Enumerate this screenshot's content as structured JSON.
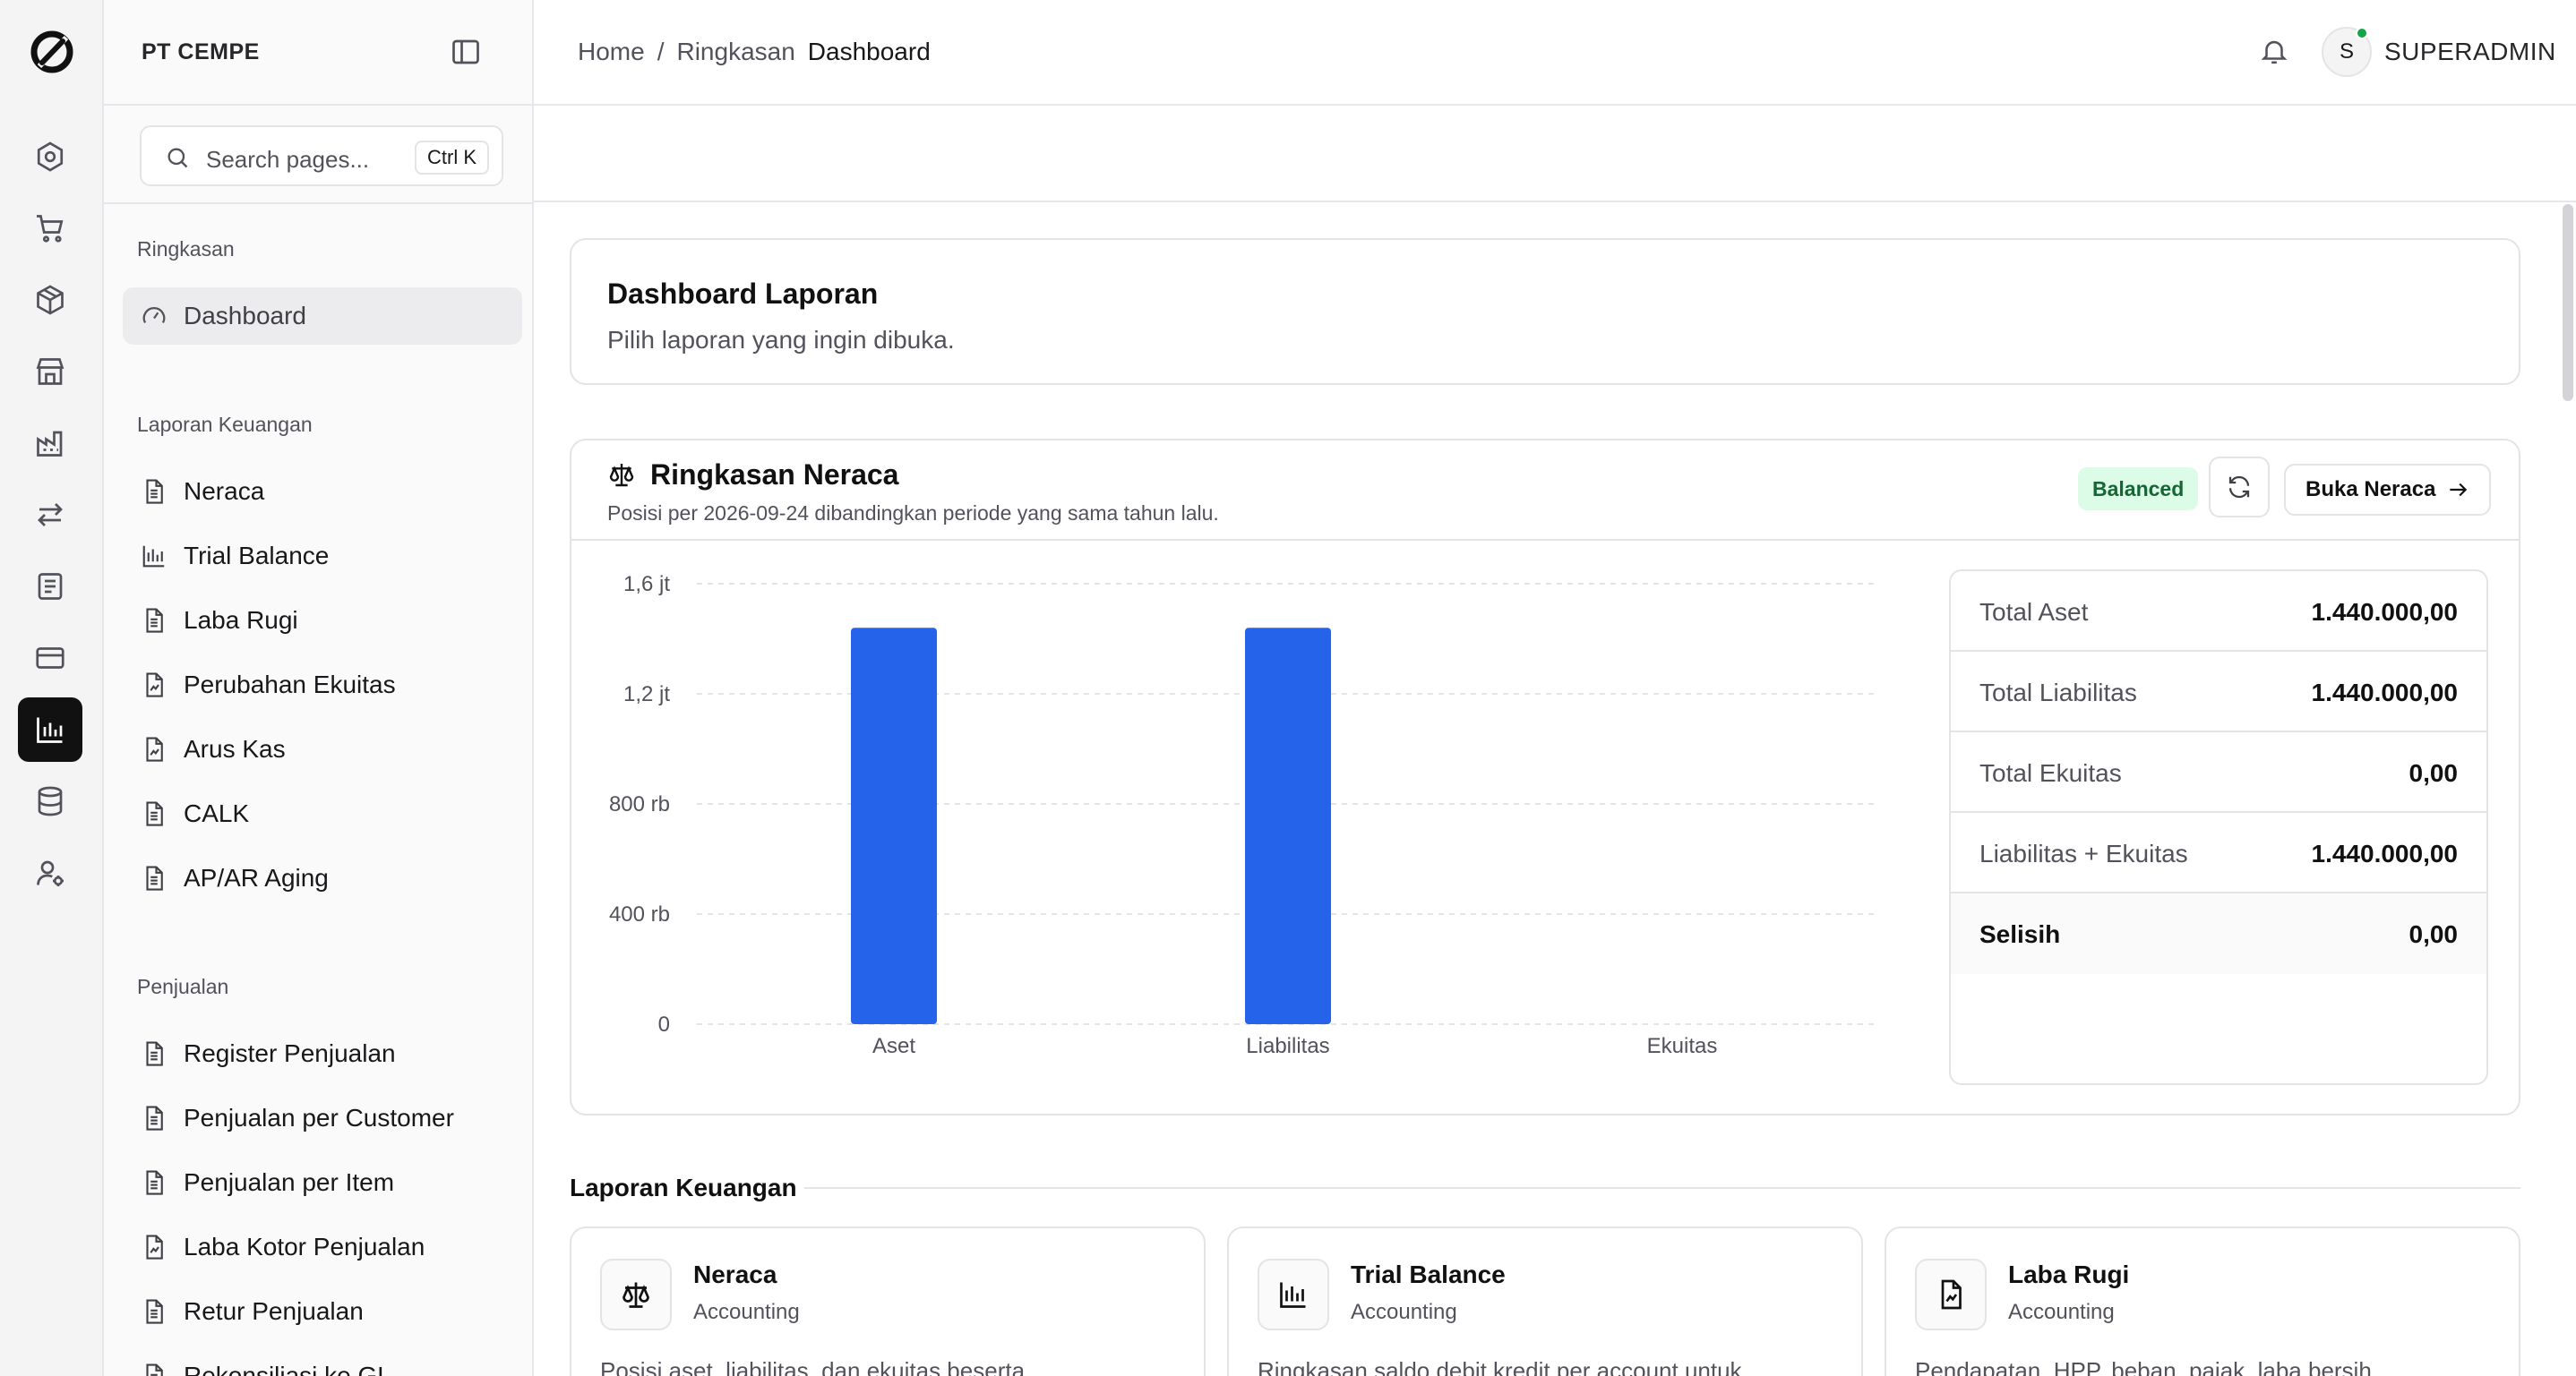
{
  "sidebar": {
    "org_name": "PT CEMPE",
    "search": {
      "placeholder": "Search pages...",
      "shortcut": "Ctrl K"
    },
    "sections": [
      {
        "label": "Ringkasan",
        "items": [
          {
            "label": "Dashboard",
            "icon": "gauge-icon",
            "active": true
          }
        ]
      },
      {
        "label": "Laporan Keuangan",
        "items": [
          {
            "label": "Neraca",
            "icon": "file-text-icon"
          },
          {
            "label": "Trial Balance",
            "icon": "bar-chart-icon"
          },
          {
            "label": "Laba Rugi",
            "icon": "file-text-icon"
          },
          {
            "label": "Perubahan Ekuitas",
            "icon": "file-chart-icon"
          },
          {
            "label": "Arus Kas",
            "icon": "file-chart-icon"
          },
          {
            "label": "CALK",
            "icon": "file-text-icon"
          },
          {
            "label": "AP/AR Aging",
            "icon": "file-text-icon"
          }
        ]
      },
      {
        "label": "Penjualan",
        "items": [
          {
            "label": "Register Penjualan",
            "icon": "file-text-icon"
          },
          {
            "label": "Penjualan per Customer",
            "icon": "file-text-icon"
          },
          {
            "label": "Penjualan per Item",
            "icon": "file-text-icon"
          },
          {
            "label": "Laba Kotor Penjualan",
            "icon": "file-chart-icon"
          },
          {
            "label": "Retur Penjualan",
            "icon": "file-text-icon"
          },
          {
            "label": "Rekonsiliasi ke GL",
            "icon": "file-text-icon"
          }
        ]
      }
    ]
  },
  "rail": {
    "icons": [
      "hexagon-icon",
      "cart-icon",
      "package-icon",
      "store-icon",
      "factory-icon",
      "transfer-icon",
      "journal-icon",
      "credit-card-icon",
      "reports-icon",
      "database-icon",
      "user-settings-icon"
    ],
    "active_index": 8
  },
  "header": {
    "breadcrumb": [
      "Home",
      "/",
      "Ringkasan",
      "Dashboard"
    ],
    "username": "SUPERADMIN",
    "avatar_initial": "S"
  },
  "dashboard": {
    "title": "Dashboard Laporan",
    "subtitle": "Pilih laporan yang ingin dibuka."
  },
  "neraca": {
    "title": "Ringkasan Neraca",
    "subtitle": "Posisi per 2026-09-24 dibandingkan periode yang sama tahun lalu.",
    "status_badge": "Balanced",
    "open_button": "Buka Neraca",
    "summary": [
      {
        "label": "Total Aset",
        "value": "1.440.000,00"
      },
      {
        "label": "Total Liabilitas",
        "value": "1.440.000,00"
      },
      {
        "label": "Total Ekuitas",
        "value": "0,00"
      },
      {
        "label": "Liabilitas + Ekuitas",
        "value": "1.440.000,00"
      },
      {
        "label": "Selisih",
        "value": "0,00"
      }
    ]
  },
  "chart_data": {
    "type": "bar",
    "categories": [
      "Aset",
      "Liabilitas",
      "Ekuitas"
    ],
    "values": [
      1440000,
      1440000,
      0
    ],
    "ylim": [
      0,
      1600000
    ],
    "yticks": [
      0,
      400000,
      800000,
      1200000,
      1600000
    ],
    "ytick_labels": [
      "0",
      "400 rb",
      "800 rb",
      "1,2 jt",
      "1,6 jt"
    ],
    "grid": true,
    "bar_color": "#2563eb"
  },
  "laporan": {
    "section_title": "Laporan Keuangan",
    "cards": [
      {
        "name": "Neraca",
        "category": "Accounting",
        "description": "Posisi aset, liabilitas, dan ekuitas beserta",
        "icon": "scale-icon"
      },
      {
        "name": "Trial Balance",
        "category": "Accounting",
        "description": "Ringkasan saldo debit kredit per account untuk",
        "icon": "bar-chart-icon"
      },
      {
        "name": "Laba Rugi",
        "category": "Accounting",
        "description": "Pendapatan, HPP, beban, pajak, laba bersih",
        "icon": "file-chart-icon"
      }
    ]
  },
  "colors": {
    "accent": "#2563eb",
    "balanced_bg": "#dcfce7",
    "balanced_text": "#166534",
    "online_dot": "#16a34a"
  }
}
